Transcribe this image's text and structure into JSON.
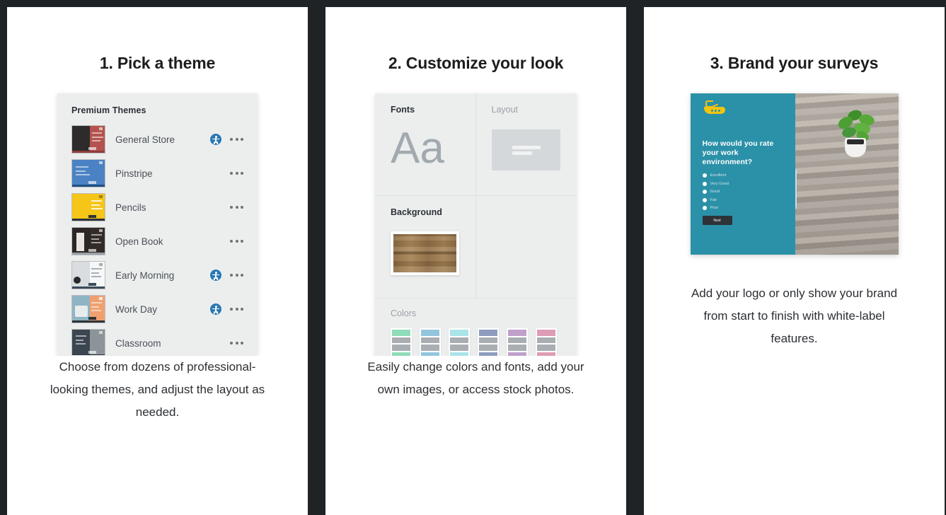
{
  "steps": [
    {
      "heading": "1. Pick a theme",
      "description": "Choose from dozens of professional-looking themes, and adjust the layout as needed.",
      "theme_panel": {
        "title": "Premium Themes",
        "themes": [
          {
            "name": "General Store",
            "accessible": true,
            "color_left": "#2d2b2c",
            "color_right": "#b4524f",
            "bar": "#8f3f3d"
          },
          {
            "name": "Pinstripe",
            "accessible": false,
            "color_left": "#4b82c4",
            "color_right": "#4b82c4",
            "bar": "#1f4f86"
          },
          {
            "name": "Pencils",
            "accessible": false,
            "color_left": "#f5c518",
            "color_right": "#f5c518",
            "bar": "#2d3338"
          },
          {
            "name": "Open Book",
            "accessible": false,
            "color_left": "#2c2724",
            "color_right": "#322c28",
            "bar": "#9aa1a6"
          },
          {
            "name": "Early Morning",
            "accessible": true,
            "color_left": "#d9dde0",
            "color_right": "#f6f7f8",
            "bar": "#3c4a5a"
          },
          {
            "name": "Work Day",
            "accessible": true,
            "color_left": "#8fb5c4",
            "color_right": "#f0a070",
            "bar": "#2d3338"
          },
          {
            "name": "Classroom",
            "accessible": false,
            "color_left": "#3b4650",
            "color_right": "#8d9499",
            "bar": "#2d3338"
          }
        ],
        "overflow_icon": "ellipsis-icon",
        "accessibility_icon": "accessibility-icon"
      }
    },
    {
      "heading": "2. Customize your look",
      "description": "Easily change colors and fonts, add your own images, or access stock photos.",
      "customize_panel": {
        "cells": [
          {
            "label": "Fonts",
            "muted": false,
            "sample_text": "Aa"
          },
          {
            "label": "Layout",
            "muted": true
          },
          {
            "label": "Background",
            "muted": false
          },
          {
            "label": "Colors",
            "muted": true
          }
        ],
        "font_sample": "Aa",
        "color_swatches": [
          "#8fdcb8",
          "#92c5dd",
          "#a9e4e9",
          "#8f9cbf",
          "#bfa0cb",
          "#dd9cb5"
        ]
      }
    },
    {
      "heading": "3. Brand your surveys",
      "description": "Add your logo or only show your brand from start to finish with white-label features.",
      "survey_preview": {
        "brand_color": "#2b91a8",
        "logo_color": "#f2c410",
        "logo_icon": "boat-logo-icon",
        "question": "How would you rate your work environment?",
        "options": [
          "Excellent",
          "Very Good",
          "Good",
          "Fair",
          "Poor"
        ],
        "next_label": "Next"
      }
    }
  ]
}
